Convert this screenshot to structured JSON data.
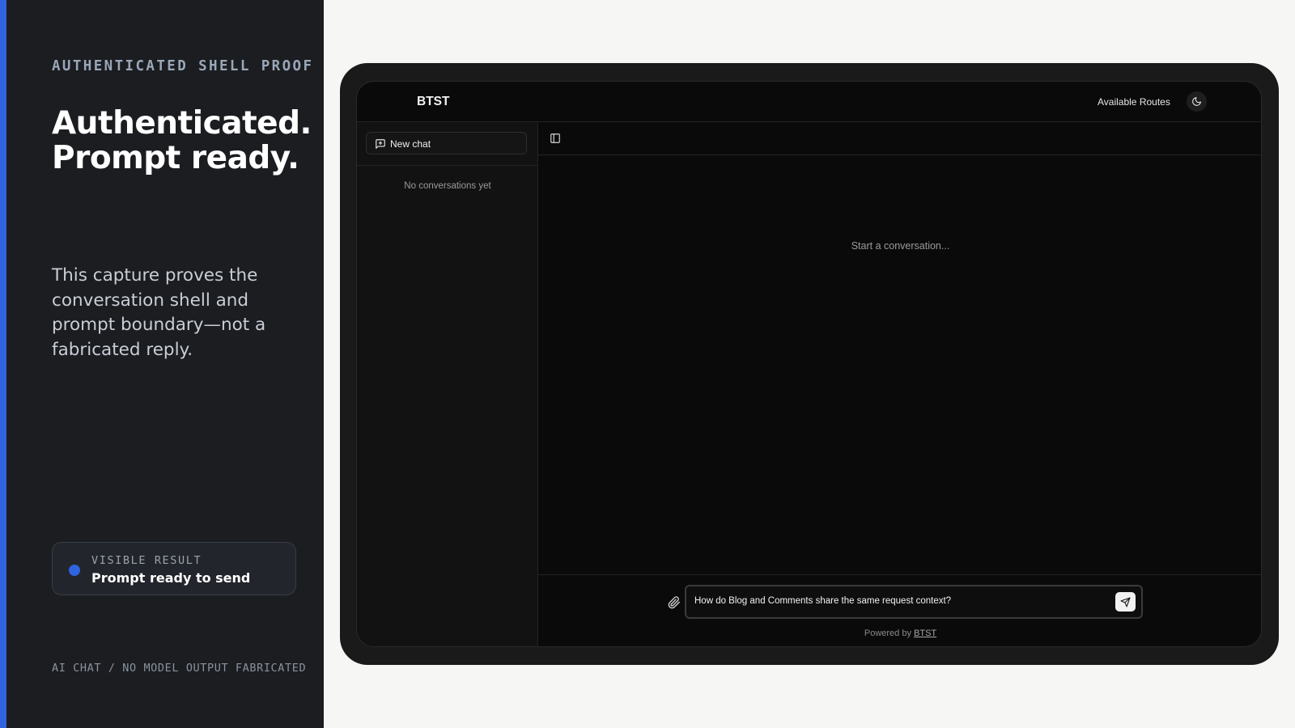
{
  "left_panel": {
    "eyebrow": "AUTHENTICATED SHELL PROOF",
    "headline_line1": "Authenticated.",
    "headline_line2": "Prompt ready.",
    "description": "This capture proves the conversation shell and prompt boundary—not a fabricated reply.",
    "result_card": {
      "label": "VISIBLE RESULT",
      "value": "Prompt ready to send"
    },
    "footnote": "AI CHAT / NO MODEL OUTPUT FABRICATED"
  },
  "app": {
    "brand": "BTST",
    "header": {
      "routes_link": "Available Routes",
      "theme_icon": "moon-icon"
    },
    "sidebar": {
      "new_chat_label": "New chat",
      "new_chat_icon": "message-plus-icon",
      "empty_text": "No conversations yet"
    },
    "main": {
      "toggle_icon": "sidebar-toggle-icon",
      "empty_state": "Start a conversation...",
      "composer": {
        "prompt_value": "How do Blog and Comments share the same request context?",
        "attach_icon": "paperclip-icon",
        "send_icon": "send-icon",
        "powered_by_prefix": "Powered by",
        "powered_by_link": "BTST"
      }
    }
  },
  "colors": {
    "accent": "#2f63e0",
    "left_panel_bg": "#1b1d21",
    "page_bg": "#f6f6f4",
    "app_bg": "#0a0a0a"
  }
}
